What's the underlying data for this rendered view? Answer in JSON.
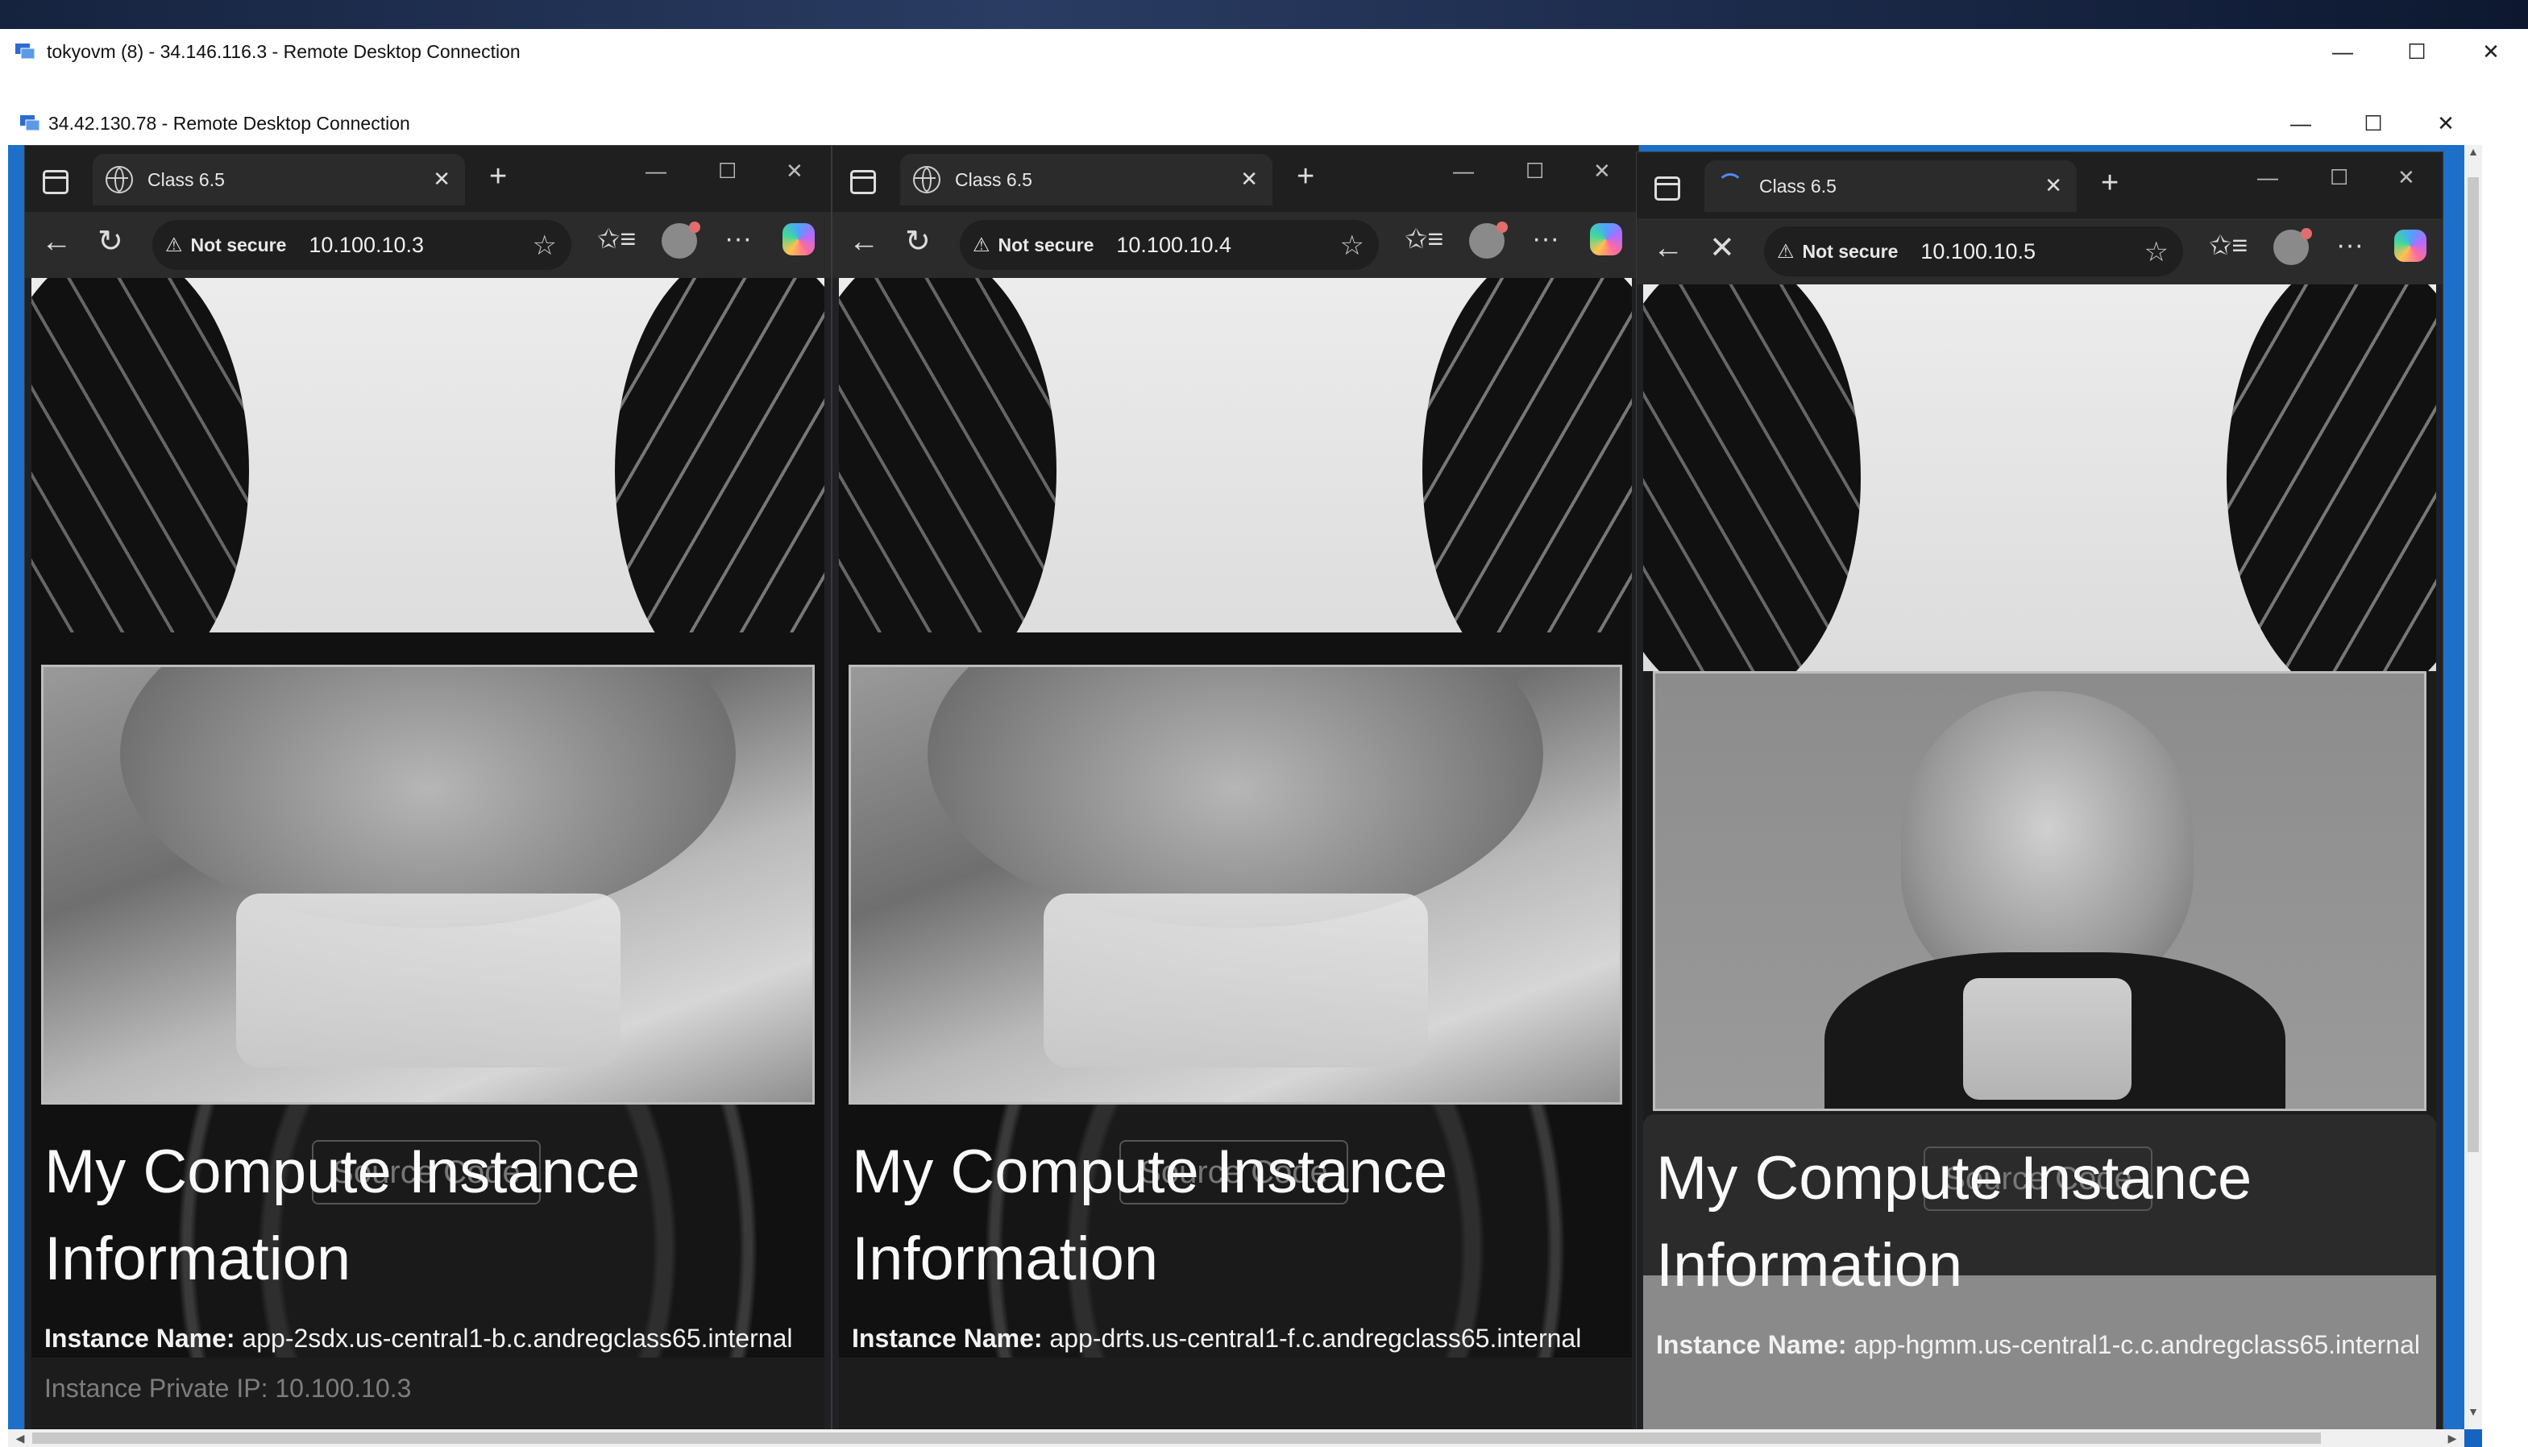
{
  "outer_window": {
    "title": "tokyovm (8) - 34.146.116.3 - Remote Desktop Connection",
    "controls": {
      "minimize": "—",
      "maximize": "☐",
      "close": "✕"
    }
  },
  "inner_window": {
    "title": "34.42.130.78 - Remote Desktop Connection",
    "controls": {
      "minimize": "—",
      "maximize": "☐",
      "close": "✕"
    }
  },
  "browsers": [
    {
      "tab_title": "Class 6.5",
      "security_label": "Not secure",
      "url": "10.100.10.3",
      "loading": false,
      "page": {
        "source_button": "Source Code",
        "heading": "My Compute Instance Information",
        "instance_label": "Instance Name:",
        "instance_value": "app-2sdx.us-central1-b.c.andregclass65.internal",
        "next_row": "Instance Private IP: 10.100.10.3"
      }
    },
    {
      "tab_title": "Class 6.5",
      "security_label": "Not secure",
      "url": "10.100.10.4",
      "loading": false,
      "page": {
        "source_button": "Source Code",
        "heading": "My Compute Instance Information",
        "instance_label": "Instance Name:",
        "instance_value": "app-drts.us-central1-f.c.andregclass65.internal"
      }
    },
    {
      "tab_title": "Class 6.5",
      "security_label": "Not secure",
      "url": "10.100.10.5",
      "loading": true,
      "page": {
        "source_button": "Source Code",
        "heading": "My Compute Instance Information",
        "instance_label": "Instance Name:",
        "instance_value": "app-hgmm.us-central1-c.c.andregclass65.internal"
      }
    }
  ],
  "icons": {
    "back": "←",
    "reload": "↻",
    "stop": "✕",
    "star": "☆",
    "favorites": "✩≡",
    "more": "···",
    "new_tab": "+",
    "warning": "⚠",
    "tab_close": "✕"
  }
}
